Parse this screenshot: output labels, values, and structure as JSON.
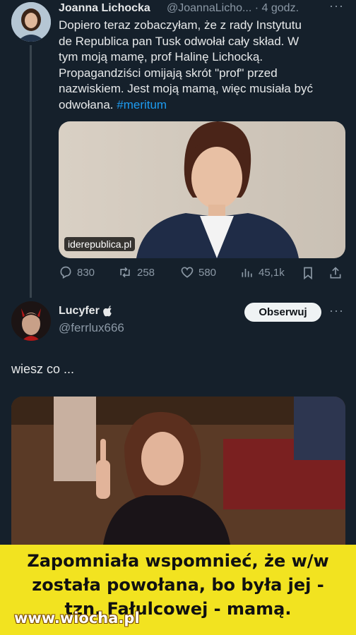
{
  "tweet1": {
    "author_name": "Joanna Lichocka",
    "handle_time": "@JoannaLicho... · 4 godz.",
    "text_lines": [
      "Dopiero teraz zobaczyłam, że z rady Instytutu",
      "de Republica pan Tusk odwołał cały skład. W",
      "tym moją mamę, prof Halinę Lichocką.",
      "Propagandziści omijają skrót \"prof\" przed",
      "nazwiskiem. Jest moją mamą, więc musiała być",
      "odwołana."
    ],
    "hashtag": "#meritum",
    "image_caption": "iderepublica.pl",
    "stats": {
      "replies": "830",
      "retweets": "258",
      "likes": "580",
      "views": "45,1k"
    }
  },
  "tweet2": {
    "author_name": "Lucyfer",
    "handle": "@ferrlux666",
    "follow_label": "Obserwuj",
    "text": "wiesz co ..."
  },
  "banner": {
    "lines": [
      "Zapomniała wspomnieć, że w/w",
      "została powołana, bo była jej -",
      "tzn. Fałulcowej - mamą."
    ],
    "watermark": "www.wiocha.pl"
  },
  "colors": {
    "background": "#15202b",
    "accent": "#1d9bf0",
    "banner": "#f2e320"
  }
}
